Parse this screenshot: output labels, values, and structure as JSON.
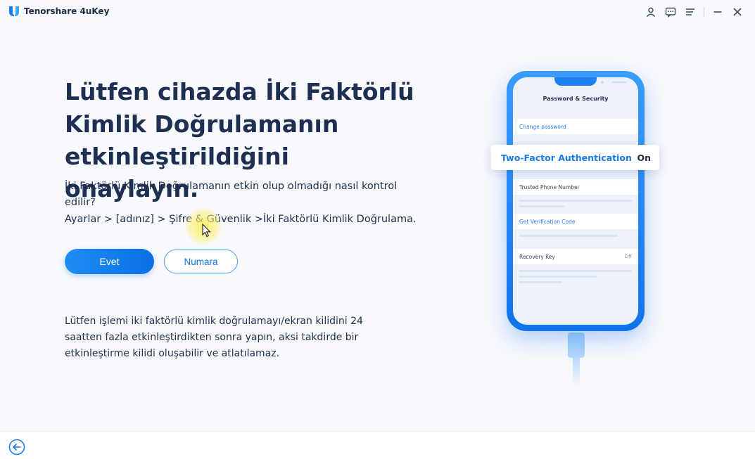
{
  "app": {
    "title": "Tenorshare 4uKey"
  },
  "window_controls": [
    {
      "name": "user-icon"
    },
    {
      "name": "feedback-icon"
    },
    {
      "name": "menu-icon"
    },
    {
      "name": "minimize-icon"
    },
    {
      "name": "close-icon"
    }
  ],
  "main": {
    "headline": "Lütfen cihazda İki Faktörlü Kimlik Doğrulamanın etkinleştirildiğini onaylayın.",
    "question": "İki Faktörlü Kimlik Doğrulamanın etkin olup olmadığı nasıl kontrol edilir?",
    "path": "Ayarlar > [adınız] > Şifre & Güvenlik >İki Faktörlü Kimlik Doğrulama.",
    "yes_button": "Evet",
    "no_button": "Numara",
    "notice": "Lütfen işlemi iki faktörlü kimlik doğrulamayı/ekran kilidini 24 saatten fazla etkinleştirdikten sonra yapın, aksi takdirde bir etkinleştirme kilidi oluşabilir ve atlatılamaz."
  },
  "phone": {
    "screen_title": "Password & Security",
    "change_password": "Change password",
    "two_factor_label": "Two-Factor Authentication",
    "two_factor_state": "On",
    "trusted_phone": "Trusted Phone Number",
    "get_code": "Get Verification Code",
    "recovery_key": "Recovery Key",
    "recovery_state": "Off"
  },
  "colors": {
    "accent": "#0d70e3",
    "phone_body": "#1f80f0",
    "headline": "#1e2f52"
  }
}
